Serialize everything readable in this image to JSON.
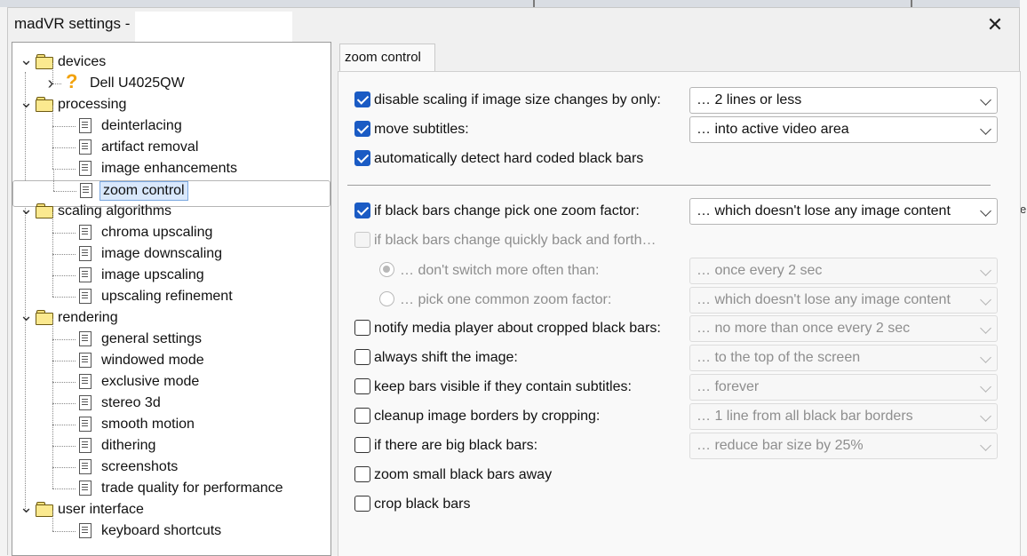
{
  "window": {
    "title": "madVR settings -",
    "close_glyph": "✕"
  },
  "tree": {
    "nodes": [
      {
        "label": "devices",
        "type": "folder"
      },
      {
        "label": "Dell U4025QW",
        "type": "device"
      },
      {
        "label": "processing",
        "type": "folder"
      },
      {
        "label": "deinterlacing",
        "type": "page"
      },
      {
        "label": "artifact removal",
        "type": "page"
      },
      {
        "label": "image enhancements",
        "type": "page"
      },
      {
        "label": "zoom control",
        "type": "page",
        "selected": true
      },
      {
        "label": "scaling algorithms",
        "type": "folder"
      },
      {
        "label": "chroma upscaling",
        "type": "page"
      },
      {
        "label": "image downscaling",
        "type": "page"
      },
      {
        "label": "image upscaling",
        "type": "page"
      },
      {
        "label": "upscaling refinement",
        "type": "page"
      },
      {
        "label": "rendering",
        "type": "folder"
      },
      {
        "label": "general settings",
        "type": "page"
      },
      {
        "label": "windowed mode",
        "type": "page"
      },
      {
        "label": "exclusive mode",
        "type": "page"
      },
      {
        "label": "stereo 3d",
        "type": "page"
      },
      {
        "label": "smooth motion",
        "type": "page"
      },
      {
        "label": "dithering",
        "type": "page"
      },
      {
        "label": "screenshots",
        "type": "page"
      },
      {
        "label": "trade quality for performance",
        "type": "page"
      },
      {
        "label": "user interface",
        "type": "folder"
      },
      {
        "label": "keyboard shortcuts",
        "type": "page"
      }
    ]
  },
  "panel": {
    "tab_label": "zoom control",
    "options": [
      {
        "label": "disable scaling if image size changes by only:",
        "checked": true,
        "enabled": true,
        "value": "… 2 lines or less"
      },
      {
        "label": "move subtitles:",
        "checked": true,
        "enabled": true,
        "value": "… into active video area"
      },
      {
        "label": "automatically detect hard coded black bars",
        "checked": true,
        "enabled": true
      },
      {
        "label": "if black bars change pick one zoom factor:",
        "checked": true,
        "enabled": true,
        "value": "… which doesn't lose any image content"
      },
      {
        "label": "if black bars change quickly back and forth…",
        "checked": false,
        "enabled": false
      },
      {
        "label": "… don't switch more often than:",
        "radio": true,
        "checked": true,
        "enabled": false,
        "value": "… once every 2 sec"
      },
      {
        "label": "… pick one common zoom factor:",
        "radio": true,
        "checked": false,
        "enabled": false,
        "value": "… which doesn't lose any image content"
      },
      {
        "label": "notify media player about cropped black bars:",
        "checked": false,
        "enabled": true,
        "value": "… no more than once every 2 sec",
        "value_enabled": false
      },
      {
        "label": "always shift the image:",
        "checked": false,
        "enabled": true,
        "value": "… to the top of the screen",
        "value_enabled": false
      },
      {
        "label": "keep bars visible if they contain subtitles:",
        "checked": false,
        "enabled": true,
        "value": "… forever",
        "value_enabled": false
      },
      {
        "label": "cleanup image borders by cropping:",
        "checked": false,
        "enabled": true,
        "value": "… 1 line from all black bar borders",
        "value_enabled": false
      },
      {
        "label": "if there are big black bars:",
        "checked": false,
        "enabled": true,
        "value": "… reduce bar size by 25%",
        "value_enabled": false
      },
      {
        "label": "zoom small black bars away",
        "checked": false,
        "enabled": true
      },
      {
        "label": "crop black bars",
        "checked": false,
        "enabled": true
      }
    ]
  },
  "colors": {
    "accent": "#1a5bc4",
    "folder": "#fbe98f",
    "selection": "#d9e8fb",
    "disabled_text": "#8e8e8e"
  },
  "background_right_letter": "e"
}
